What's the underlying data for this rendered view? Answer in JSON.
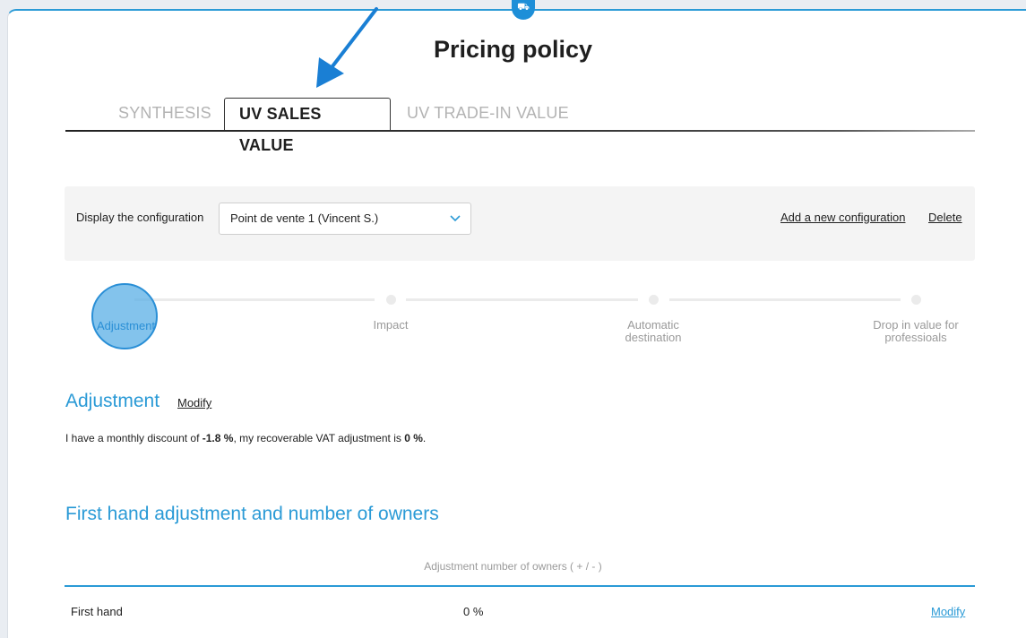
{
  "page": {
    "title": "Pricing policy"
  },
  "tabs": [
    {
      "label": "SYNTHESIS",
      "active": false
    },
    {
      "label": "UV SALES VALUE",
      "active": true
    },
    {
      "label": "UV TRADE-IN VALUE",
      "active": false
    }
  ],
  "config": {
    "label": "Display the configuration",
    "selected": "Point de vente 1 (Vincent S.)",
    "add_label": "Add a new configuration",
    "delete_label": "Delete"
  },
  "steps": [
    {
      "label": "Adjustment",
      "active": true
    },
    {
      "label": "Impact",
      "active": false
    },
    {
      "label": "Automatic destination",
      "line1": "Automatic",
      "line2": "destination",
      "active": false
    },
    {
      "label": "Drop in value for professioals",
      "line1": "Drop in value for",
      "line2": "professioals",
      "active": false
    }
  ],
  "adjustment": {
    "title": "Adjustment",
    "modify_label": "Modify",
    "desc_prefix": "I have a monthly discount of ",
    "monthly_discount": "-1.8 %",
    "desc_middle": ", my recoverable VAT adjustment is ",
    "vat_adjustment": "0 %",
    "desc_suffix": "."
  },
  "owners": {
    "title": "First hand adjustment and number of owners",
    "column_header": "Adjustment number of owners ( + / - )",
    "rows": [
      {
        "label": "First hand",
        "value": "0 %",
        "action": "Modify"
      }
    ]
  },
  "colors": {
    "accent": "#2a9ad6",
    "arrow": "#1a7fd4"
  },
  "icons": {
    "top_badge": "car-icon",
    "select_arrow": "chevron-down-icon"
  }
}
